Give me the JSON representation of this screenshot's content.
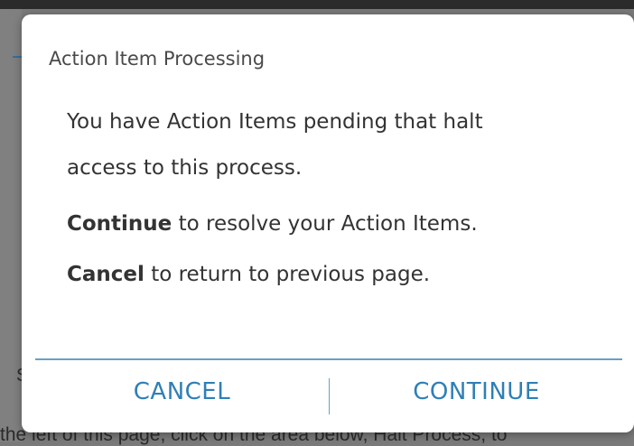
{
  "dialog": {
    "title": "Action Item Processing",
    "message_line1": "You have Action Items pending that halt",
    "message_line2": "access to this process.",
    "continue_keyword": "Continue",
    "continue_text": " to resolve your Action Items.",
    "cancel_keyword": "Cancel",
    "cancel_text": " to return to previous page.",
    "cancel_button": "CANCEL",
    "continue_button": "CONTINUE"
  },
  "background": {
    "partial_letter": "S",
    "bottom_text": "the left of this page, click on the area below, Halt Process, to"
  },
  "colors": {
    "accent": "#2f7fb6",
    "divider": "#6b9fc4",
    "overlay": "#7a7a7a"
  }
}
